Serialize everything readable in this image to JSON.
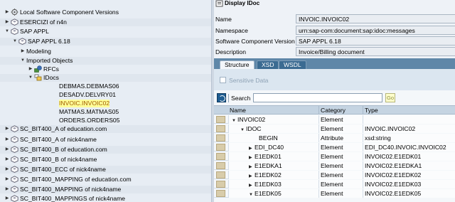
{
  "tree": {
    "items": [
      {
        "label": "Local Software Component Versions",
        "arrow": "▶",
        "icon": "component-icon"
      },
      {
        "label": "ESERCIZI of n4n",
        "arrow": "▶",
        "icon": "swcv-icon"
      },
      {
        "label": "SAP APPL",
        "arrow": "▼",
        "icon": "swcv-icon"
      },
      {
        "label": "SAP APPL 6.18",
        "arrow": "▼",
        "icon": "swcv-icon"
      },
      {
        "label": "Modeling",
        "arrow": "▶",
        "icon": ""
      },
      {
        "label": "Imported Objects",
        "arrow": "▼",
        "icon": ""
      },
      {
        "label": "RFCs",
        "arrow": "▶",
        "icon": "rfc-icon"
      },
      {
        "label": "IDocs",
        "arrow": "▼",
        "icon": "idoc-folder-icon"
      },
      {
        "label": "DEBMAS.DEBMAS06",
        "arrow": "",
        "icon": ""
      },
      {
        "label": "DESADV.DELVRY01",
        "arrow": "",
        "icon": ""
      },
      {
        "label": "INVOIC.INVOIC02",
        "arrow": "",
        "icon": ""
      },
      {
        "label": "MATMAS.MATMAS05",
        "arrow": "",
        "icon": ""
      },
      {
        "label": "ORDERS.ORDERS05",
        "arrow": "",
        "icon": ""
      },
      {
        "label": "SC_BIT400_A of education.com",
        "arrow": "▶",
        "icon": "swcv-icon"
      },
      {
        "label": "SC_BIT400_A of nick4name",
        "arrow": "▶",
        "icon": "swcv-icon"
      },
      {
        "label": "SC_BIT400_B of education.com",
        "arrow": "▶",
        "icon": "swcv-icon"
      },
      {
        "label": "SC_BIT400_B of nick4name",
        "arrow": "▶",
        "icon": "swcv-icon"
      },
      {
        "label": "SC_BIT400_ECC of nick4name",
        "arrow": "▶",
        "icon": "swcv-icon"
      },
      {
        "label": "SC_BIT400_MAPPING of education.com",
        "arrow": "▶",
        "icon": "swcv-icon"
      },
      {
        "label": "SC_BIT400_MAPPING of nick4name",
        "arrow": "▶",
        "icon": "swcv-icon"
      },
      {
        "label": "SC_BIT400_MAPPINGS of nick4name",
        "arrow": "▶",
        "icon": "swcv-icon"
      }
    ],
    "selected_label": "INVOIC.INVOIC02"
  },
  "detail": {
    "title": "Display IDoc",
    "title_icon": "idoc-icon",
    "fields": [
      {
        "label": "Name",
        "value": "INVOIC.INVOIC02"
      },
      {
        "label": "Namespace",
        "value": "urn:sap-com:document:sap:idoc:messages"
      },
      {
        "label": "Software Component Version",
        "value": "SAP APPL 6.18"
      },
      {
        "label": "Description",
        "value": "Invoice/Billing document"
      }
    ],
    "tabs": [
      "Structure",
      "XSD",
      "WSDL"
    ],
    "active_tab": "Structure",
    "sensitive_label": "Sensitive Data",
    "search": {
      "label": "Search",
      "value": "",
      "go_label": "Go"
    },
    "table": {
      "columns": [
        "Name",
        "Category",
        "Type"
      ],
      "rows": [
        {
          "name": "INVOIC02",
          "caret": "▼",
          "indent": 0,
          "category": "Element",
          "type": ""
        },
        {
          "name": "IDOC",
          "caret": "▼",
          "indent": 1,
          "category": "Element",
          "type": "INVOIC.INVOIC02"
        },
        {
          "name": "BEGIN",
          "caret": "",
          "indent": 2,
          "category": "Attribute",
          "type": "xsd:string"
        },
        {
          "name": "EDI_DC40",
          "caret": "▶",
          "indent": 2,
          "category": "Element",
          "type": "EDI_DC40.INVOIC.INVOIC02"
        },
        {
          "name": "E1EDK01",
          "caret": "▶",
          "indent": 2,
          "category": "Element",
          "type": "INVOIC02.E1EDK01"
        },
        {
          "name": "E1EDKA1",
          "caret": "▶",
          "indent": 2,
          "category": "Element",
          "type": "INVOIC02.E1EDKA1"
        },
        {
          "name": "E1EDK02",
          "caret": "▶",
          "indent": 2,
          "category": "Element",
          "type": "INVOIC02.E1EDK02"
        },
        {
          "name": "E1EDK03",
          "caret": "▶",
          "indent": 2,
          "category": "Element",
          "type": "INVOIC02.E1EDK03"
        },
        {
          "name": "E1EDK05",
          "caret": "▼",
          "indent": 2,
          "category": "Element",
          "type": "INVOIC02.E1EDK05"
        }
      ]
    }
  },
  "colors": {
    "tree_bg": "#e7edf4",
    "selection_bg": "#ffff99",
    "selection_text": "#a05a00",
    "tab_bar": "#5f87a8",
    "header_bg": "#c5d4e2"
  }
}
